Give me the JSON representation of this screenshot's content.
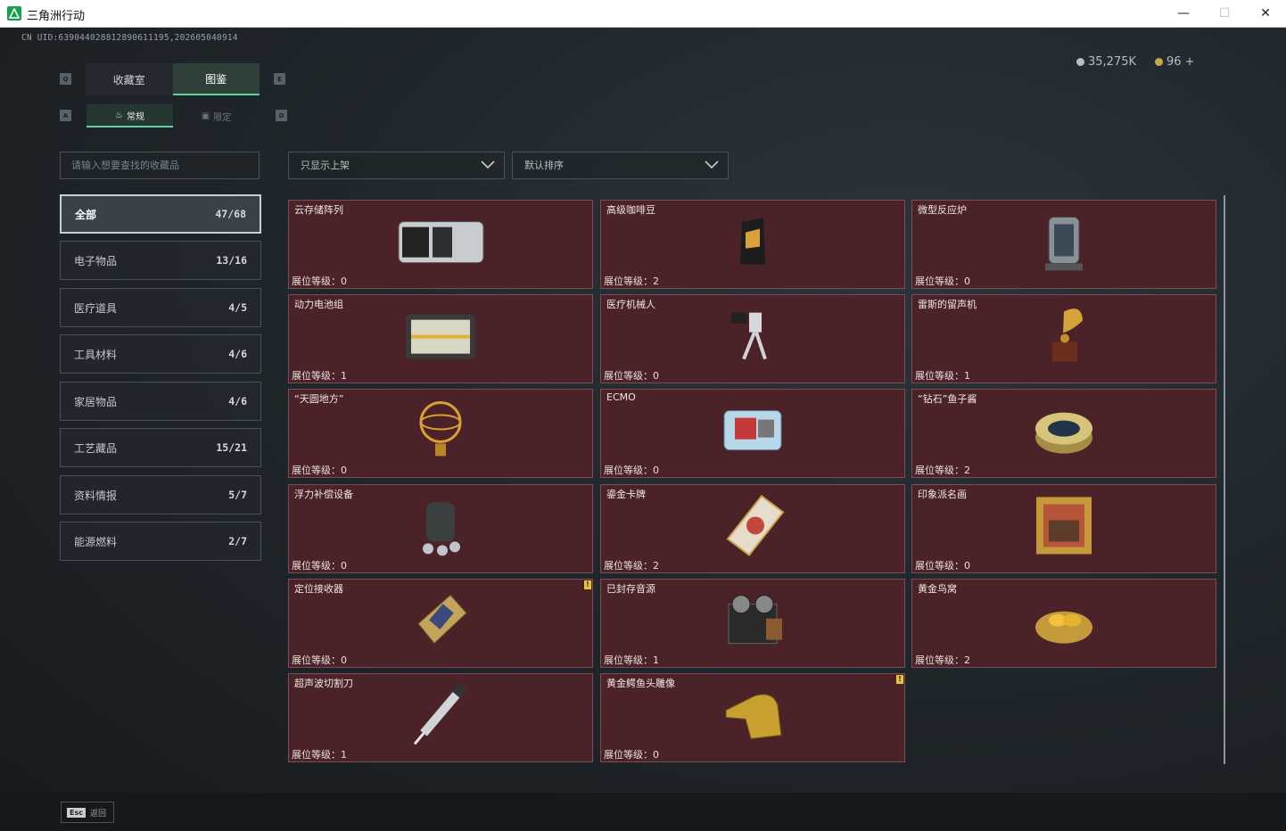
{
  "window": {
    "title": "三角洲行动",
    "min": "—",
    "max": "☐",
    "close": "✕"
  },
  "uid": "CN UID:639044028812890611195,202605040914",
  "currency": [
    {
      "icon": "silver-coin-icon",
      "value": "35,275K",
      "color": "#b9bec2"
    },
    {
      "icon": "gold-coin-icon",
      "value": "96 +",
      "color": "#c9a847"
    }
  ],
  "keyhints": {
    "tab_left": "Q",
    "tab_right": "E",
    "sub_left": "A",
    "sub_right": "D"
  },
  "tabs": [
    {
      "label": "收藏室",
      "active": false
    },
    {
      "label": "图鉴",
      "active": true
    }
  ],
  "subtabs": [
    {
      "label": "常规",
      "active": true
    },
    {
      "label": "限定",
      "active": false
    }
  ],
  "search": {
    "placeholder": "请输入想要查找的收藏品"
  },
  "filters": {
    "display": "只显示上架",
    "sort": "默认排序"
  },
  "categories": [
    {
      "label": "全部",
      "count": "47/68",
      "active": true
    },
    {
      "label": "电子物品",
      "count": "13/16"
    },
    {
      "label": "医疗道具",
      "count": "4/5"
    },
    {
      "label": "工具材料",
      "count": "4/6"
    },
    {
      "label": "家居物品",
      "count": "4/6"
    },
    {
      "label": "工艺藏品",
      "count": "15/21"
    },
    {
      "label": "资料情报",
      "count": "5/7"
    },
    {
      "label": "能源燃料",
      "count": "2/7"
    }
  ],
  "level_label": "展位等级：",
  "items": [
    {
      "name": "云存储阵列",
      "level": "0",
      "icon": "server-array-icon"
    },
    {
      "name": "高级咖啡豆",
      "level": "2",
      "icon": "coffee-bag-icon"
    },
    {
      "name": "微型反应炉",
      "level": "0",
      "icon": "reactor-icon"
    },
    {
      "name": "动力电池组",
      "level": "1",
      "icon": "battery-pack-icon"
    },
    {
      "name": "医疗机械人",
      "level": "0",
      "icon": "medical-robot-icon"
    },
    {
      "name": "雷斯的留声机",
      "level": "1",
      "icon": "gramophone-icon"
    },
    {
      "name": "“天圆地方”",
      "level": "0",
      "icon": "armillary-sphere-icon"
    },
    {
      "name": "ECMO",
      "level": "0",
      "icon": "ecmo-machine-icon"
    },
    {
      "name": "“钻石”鱼子酱",
      "level": "2",
      "icon": "caviar-tin-icon"
    },
    {
      "name": "浮力补偿设备",
      "level": "0",
      "icon": "buoyancy-device-icon"
    },
    {
      "name": "鎏金卡牌",
      "level": "2",
      "icon": "gilded-card-icon"
    },
    {
      "name": "印象派名画",
      "level": "0",
      "icon": "framed-painting-icon"
    },
    {
      "name": "定位接收器",
      "level": "0",
      "icon": "gps-receiver-icon",
      "flag": "!"
    },
    {
      "name": "已封存音源",
      "level": "1",
      "icon": "reel-recorder-icon"
    },
    {
      "name": "黄金鸟窝",
      "level": "2",
      "icon": "golden-nest-icon"
    },
    {
      "name": "超声波切割刀",
      "level": "1",
      "icon": "ultrasonic-cutter-icon"
    },
    {
      "name": "黄金鳄鱼头雕像",
      "level": "0",
      "icon": "golden-croc-head-icon",
      "flag": "!"
    }
  ],
  "footer": {
    "key": "Esc",
    "label": "返回"
  }
}
